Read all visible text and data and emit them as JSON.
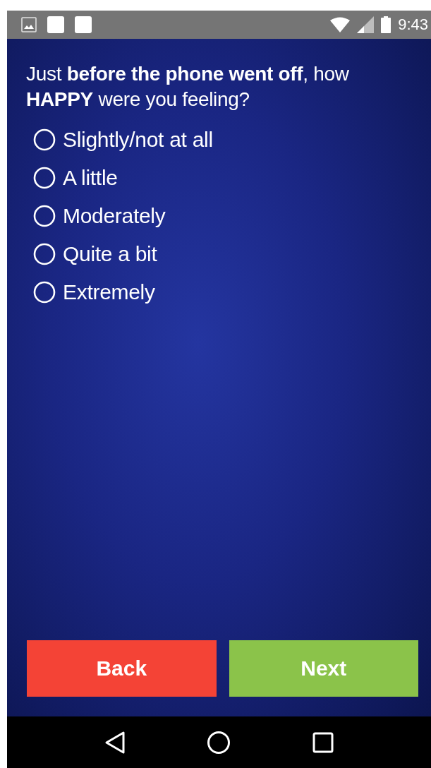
{
  "status_bar": {
    "time": "9:43"
  },
  "question": "Just **before the phone went off**, how **HAPPY** were you feeling?",
  "options": [
    {
      "label": "Slightly/not at all",
      "selected": false
    },
    {
      "label": "A little",
      "selected": false
    },
    {
      "label": "Moderately",
      "selected": false
    },
    {
      "label": "Quite a bit",
      "selected": false
    },
    {
      "label": "Extremely",
      "selected": false
    }
  ],
  "buttons": [
    {
      "label": "Back",
      "kind": "back"
    },
    {
      "label": "Next",
      "kind": "next"
    }
  ]
}
